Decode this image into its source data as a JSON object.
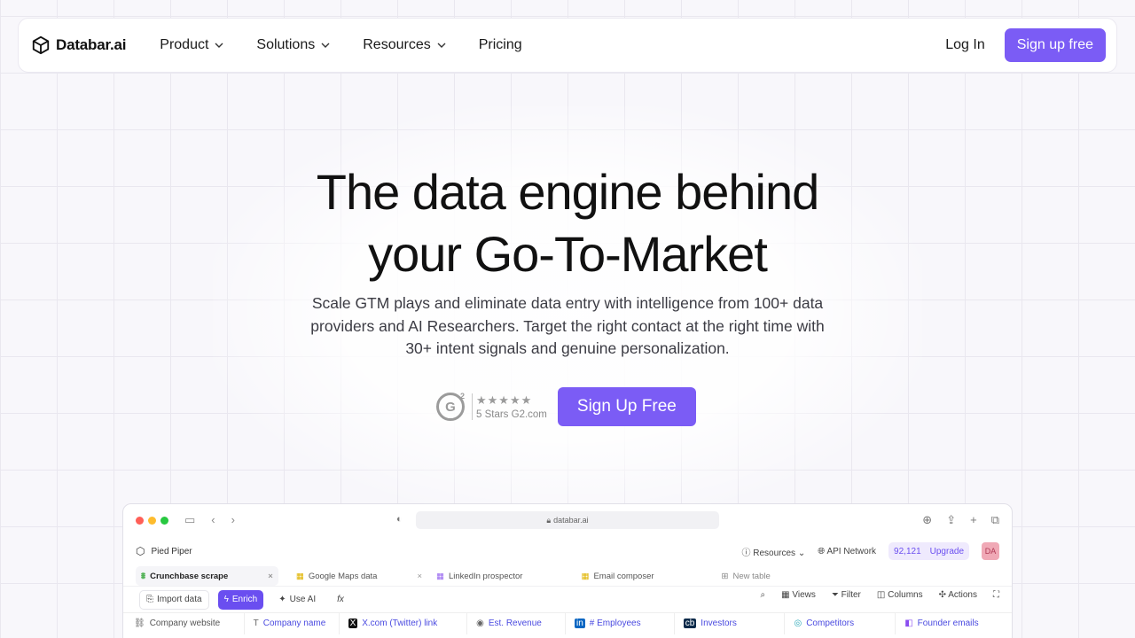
{
  "nav": {
    "logo_text": "Databar.ai",
    "items": [
      {
        "label": "Product",
        "dropdown": true
      },
      {
        "label": "Solutions",
        "dropdown": true
      },
      {
        "label": "Resources",
        "dropdown": true
      },
      {
        "label": "Pricing",
        "dropdown": false
      }
    ],
    "login_label": "Log In",
    "signup_label": "Sign up free"
  },
  "hero": {
    "title_line1": "The data engine behind",
    "title_line2": "your Go-To-Market",
    "subtitle": "Scale GTM plays and eliminate data entry with intelligence from 100+ data providers and AI Researchers. Target the right contact at the right time with 30+ intent signals and genuine personalization.",
    "rating_stars": "★★★★★",
    "rating_text": "5 Stars G2.com",
    "cta_label": "Sign Up Free"
  },
  "app": {
    "address": "databar.ai",
    "workspace_name": "Pied Piper",
    "resources_label": "Resources",
    "api_network_label": "API Network",
    "credits": "92,121",
    "upgrade_label": "Upgrade",
    "avatar_initials": "DA",
    "tabs": [
      {
        "label": "Crunchbase scrape",
        "active": true
      },
      {
        "label": "Google Maps data",
        "active": false
      },
      {
        "label": "LinkedIn prospector",
        "active": false
      },
      {
        "label": "Email composer",
        "active": false
      },
      {
        "label": "New table",
        "active": false
      }
    ],
    "toolbar": {
      "import": "Import data",
      "enrich": "Enrich",
      "use_ai": "Use AI",
      "fx": "fx",
      "views": "Views",
      "filter": "Filter",
      "columns": "Columns",
      "actions": "Actions"
    },
    "columns": [
      "Company website",
      "Company name",
      "X.com (Twitter) link",
      "Est. Revenue",
      "# Employees",
      "Investors",
      "Competitors",
      "Founder emails"
    ]
  },
  "colors": {
    "accent": "#7b5cf5",
    "background": "#f8f7fb"
  }
}
